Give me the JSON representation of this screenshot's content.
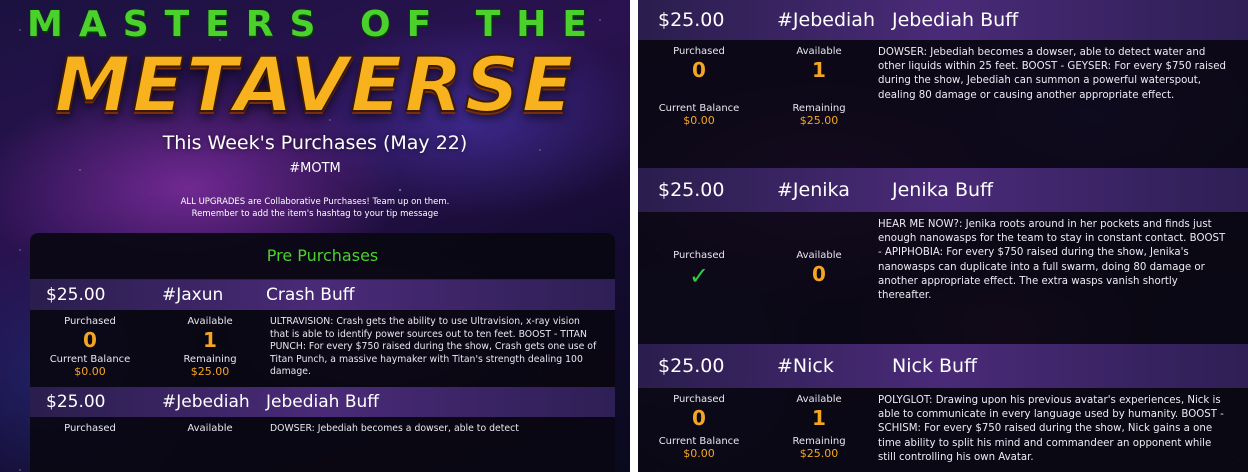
{
  "header": {
    "title_top": "MASTERS OF THE",
    "title_main": "METAVERSE",
    "week_title": "This Week's Purchases (May 22)",
    "hashtag": "#MOTM",
    "note_line1": "ALL UPGRADES are Collaborative Purchases! Team up on them.",
    "note_line2": "Remember to add the item's hashtag to your tip message"
  },
  "section_title": "Pre Purchases",
  "labels": {
    "purchased": "Purchased",
    "available": "Available",
    "current_balance": "Current Balance",
    "remaining": "Remaining"
  },
  "left_items": [
    {
      "price": "$25.00",
      "hashtag": "#Jaxun",
      "name": "Crash Buff",
      "purchased": "0",
      "available": "1",
      "balance": "$0.00",
      "remaining": "$25.00",
      "description": "ULTRAVISION: Crash gets the ability to use Ultravision, x-ray vision that is able to identify power sources out to ten feet.  BOOST - TITAN PUNCH: For every $750 raised during the show, Crash gets one use of Titan Punch, a massive haymaker with Titan's strength dealing 100 damage."
    },
    {
      "price": "$25.00",
      "hashtag": "#Jebediah",
      "name": "Jebediah Buff",
      "purchased": "",
      "available": "",
      "description": "DOWSER: Jebediah becomes a dowser, able to detect"
    }
  ],
  "right_items": [
    {
      "price": "$25.00",
      "hashtag": "#Jebediah",
      "name": "Jebediah Buff",
      "purchased": "0",
      "available": "1",
      "balance": "$0.00",
      "remaining": "$25.00",
      "description": "DOWSER: Jebediah becomes a dowser, able to detect water and other liquids within 25 feet.  BOOST - GEYSER: For every $750 raised during the show, Jebediah can summon a powerful waterspout, dealing 80 damage or causing another appropriate effect."
    },
    {
      "price": "$25.00",
      "hashtag": "#Jenika",
      "name": "Jenika Buff",
      "purchased": "✓",
      "available": "0",
      "description": "HEAR ME NOW?: Jenika roots around in her pockets and finds just enough nanowasps for the team to stay in constant contact.  BOOST - APIPHOBIA: For every $750 raised during the show, Jenika's nanowasps can duplicate into a full swarm, doing 80 damage or another appropriate effect.  The extra wasps vanish shortly thereafter."
    },
    {
      "price": "$25.00",
      "hashtag": "#Nick",
      "name": "Nick Buff",
      "purchased": "0",
      "available": "1",
      "balance": "$0.00",
      "remaining": "$25.00",
      "description": "POLYGLOT: Drawing upon his previous avatar's experiences, Nick is able to communicate in every language used by humanity.  BOOST - SCHISM: For every $750 raised during the show, Nick gains a one time ability to split his mind and commandeer an opponent while still controlling his own Avatar."
    }
  ],
  "colors": {
    "accent_green": "#4bd12c",
    "value_orange": "#f4a623",
    "check_green": "#2ecc40",
    "header_purple": "#4a2a78"
  }
}
